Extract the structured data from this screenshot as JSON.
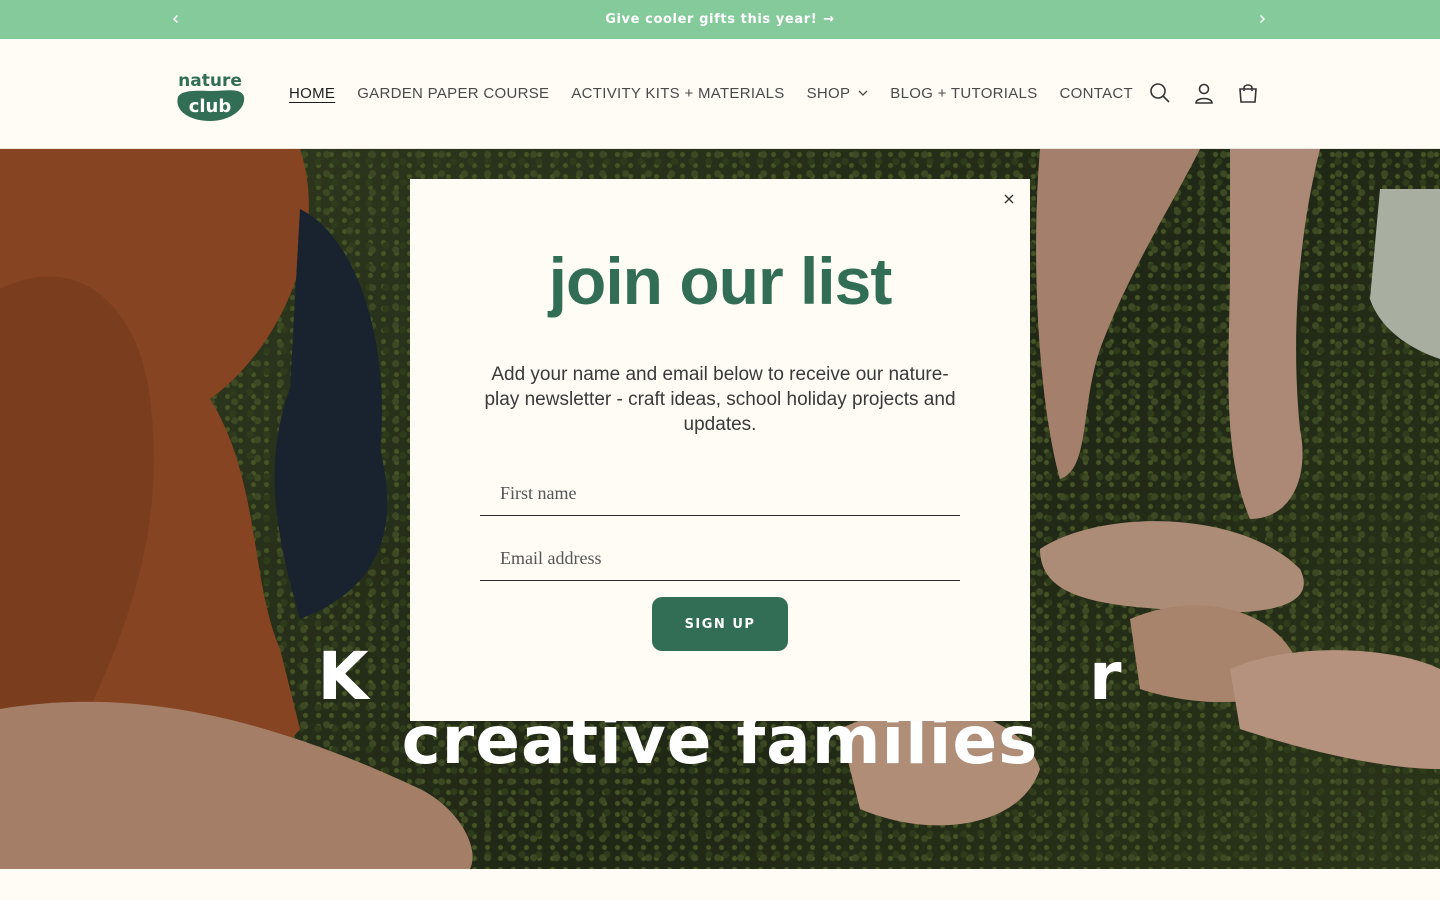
{
  "announcement": {
    "message": "Give cooler gifts this year!",
    "arrow": "→"
  },
  "header": {
    "logo_text": [
      "nature",
      "club"
    ],
    "nav": [
      {
        "label": "HOME",
        "active": true
      },
      {
        "label": "GARDEN PAPER COURSE"
      },
      {
        "label": "ACTIVITY KITS + MATERIALS"
      },
      {
        "label": "SHOP",
        "dropdown": true
      },
      {
        "label": "BLOG + TUTORIALS"
      },
      {
        "label": "CONTACT"
      }
    ],
    "icons": [
      "search-icon",
      "account-icon",
      "cart-icon"
    ]
  },
  "hero": {
    "line1": "K                              r",
    "line2": "creative families"
  },
  "popup": {
    "title": "join our list",
    "description": "Add your name and email below to receive our nature-play newsletter - craft ideas, school holiday projects and updates.",
    "first_name_placeholder": "First name",
    "email_placeholder": "Email address",
    "button_label": "SIGN UP"
  },
  "colors": {
    "accent_green": "#326e55",
    "announce_bg": "#85ca9b",
    "background": "#fffcf5"
  }
}
